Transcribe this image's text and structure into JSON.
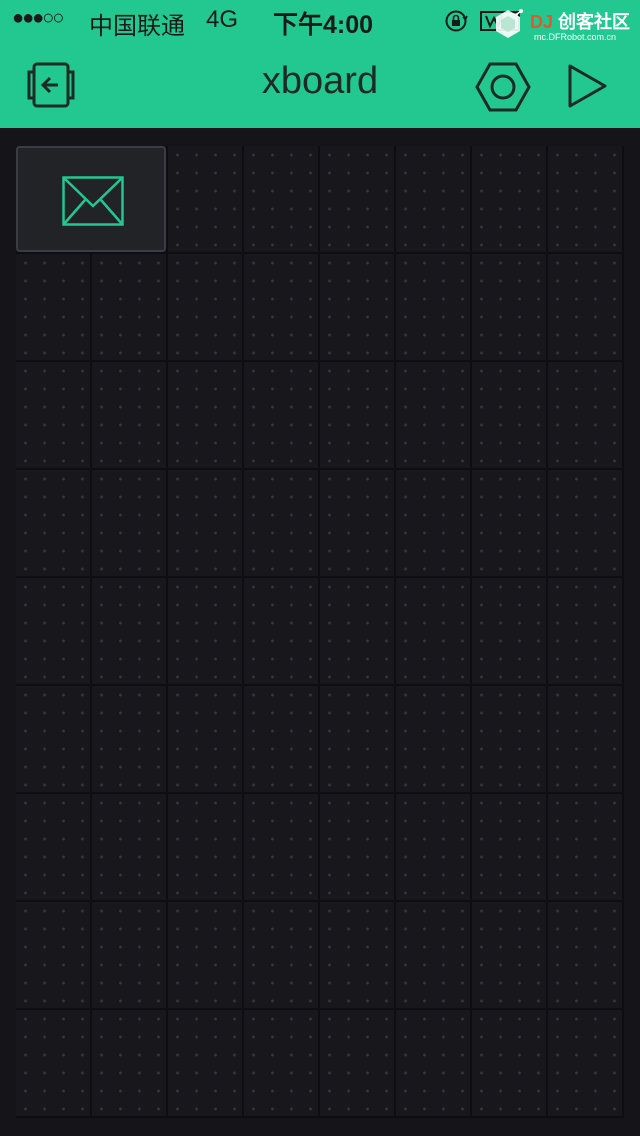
{
  "status_bar": {
    "signal": "●●●○○",
    "carrier": "中国联通",
    "network": "4G",
    "time": "下午4:00"
  },
  "watermark": {
    "brand_prefix": "DJ",
    "brand": "创客社区",
    "url": "mc.DFRobot.com.cn"
  },
  "app_bar": {
    "title": "xboard",
    "back_icon": "exit-device-icon",
    "settings_icon": "hexagon-settings-icon",
    "play_icon": "play-triangle-icon"
  },
  "canvas": {
    "widgets": [
      {
        "type": "email",
        "icon": "envelope-icon"
      }
    ]
  },
  "colors": {
    "accent": "#23c890",
    "background": "#141419",
    "grid_cell": "#17171c",
    "widget_bg": "#222327",
    "icon_stroke_dark": "#1c2b25",
    "icon_stroke_accent": "#23c890"
  }
}
